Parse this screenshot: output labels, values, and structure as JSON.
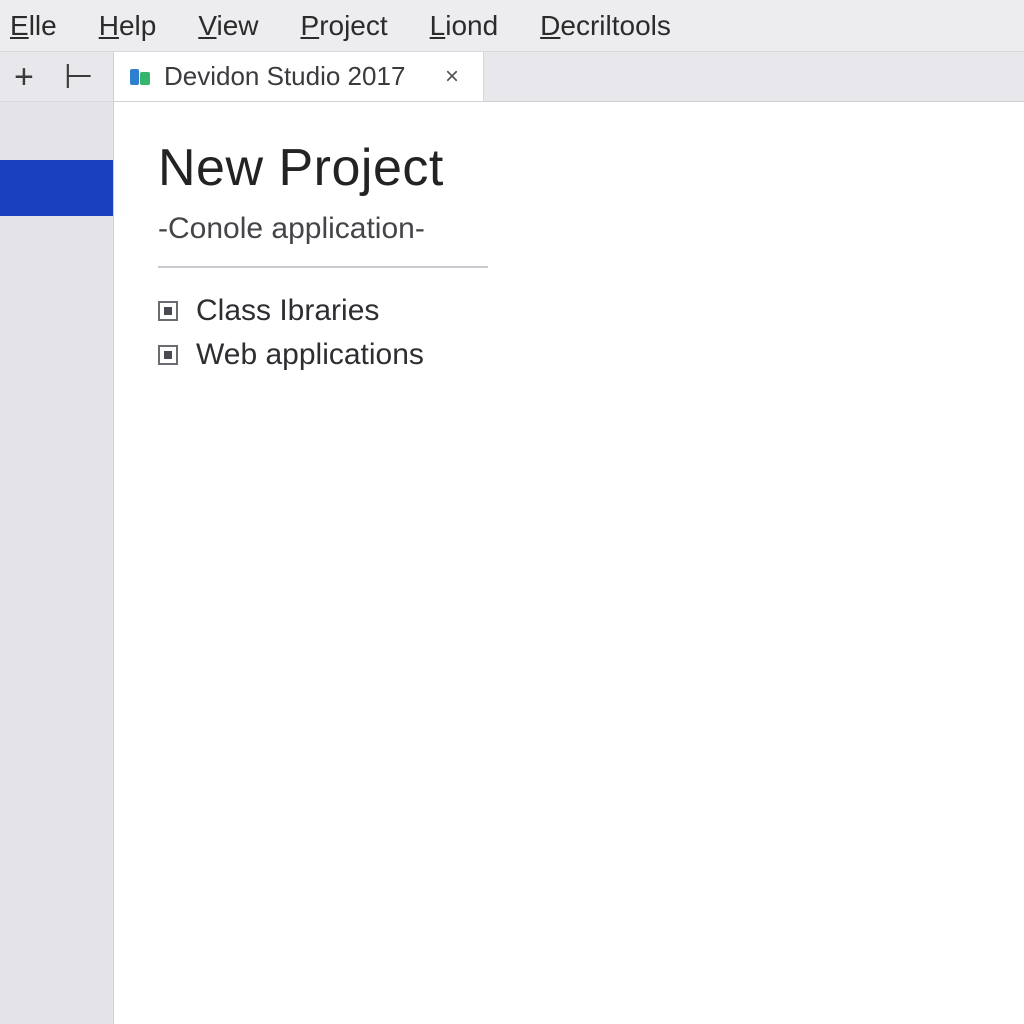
{
  "menu": {
    "items": [
      {
        "prefix": "E",
        "rest": "lle"
      },
      {
        "prefix": "H",
        "rest": "elp"
      },
      {
        "prefix": "V",
        "rest": "iew"
      },
      {
        "prefix": "P",
        "rest": "roject"
      },
      {
        "prefix": "L",
        "rest": "iond"
      },
      {
        "prefix": "D",
        "rest": "ecriltools"
      }
    ]
  },
  "sidebar": {
    "tools": {
      "add": "+",
      "collapse": "⊢"
    }
  },
  "tab": {
    "title": "Devidon Studio 2017",
    "close": "×"
  },
  "page": {
    "heading": "New Project",
    "subtitle": "-Conole application-",
    "options": [
      "Class Ibraries",
      "Web applications"
    ]
  },
  "colors": {
    "selection": "#1a3fbf"
  }
}
